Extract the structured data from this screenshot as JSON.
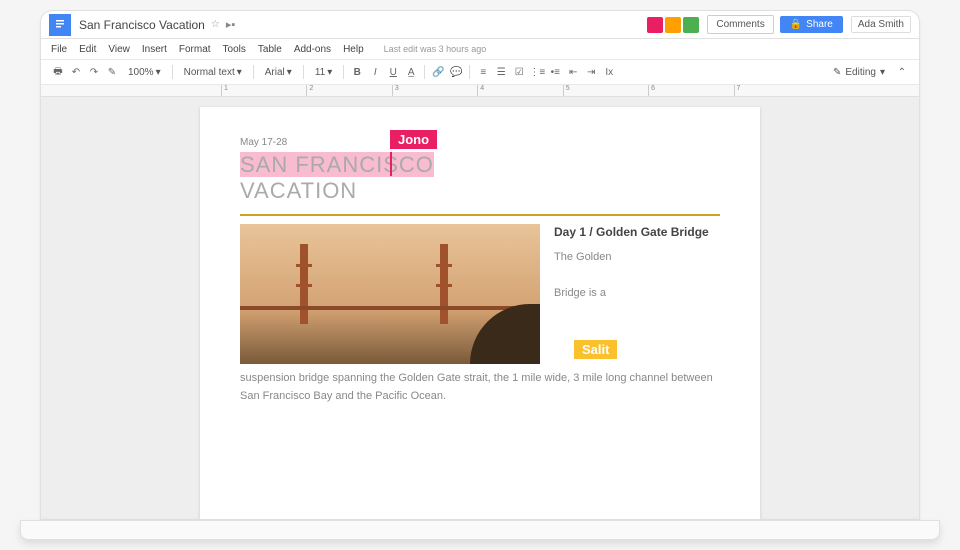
{
  "title": "San Francisco Vacation",
  "user": "Ada Smith",
  "buttons": {
    "comments": "Comments",
    "share": "Share"
  },
  "menu": [
    "File",
    "Edit",
    "View",
    "Insert",
    "Format",
    "Tools",
    "Table",
    "Add-ons",
    "Help"
  ],
  "last_edit": "Last edit was 3 hours ago",
  "toolbar": {
    "zoom": "100%",
    "style": "Normal text",
    "font": "Arial",
    "size": "11",
    "editing": "Editing"
  },
  "ruler_ticks": [
    "1",
    "2",
    "3",
    "4",
    "5",
    "6",
    "7"
  ],
  "doc": {
    "date": "May 17-28",
    "heading1": "SAN FRANCISCO",
    "heading2": "VACATION",
    "dayhead": "Day 1 / Golden Gate Bridge",
    "partial": "The Golden",
    "partial2": "Bridge is a",
    "body": "suspension bridge spanning the Golden Gate strait, the 1 mile wide, 3 mile long channel between San Francisco Bay and the Pacific Ocean."
  },
  "collaborators": {
    "jono": "Jono",
    "salit": "Salit"
  },
  "colors": {
    "accent_pink": "#e91e63",
    "accent_gold": "#fbc02d",
    "brand": "#4285f4"
  }
}
